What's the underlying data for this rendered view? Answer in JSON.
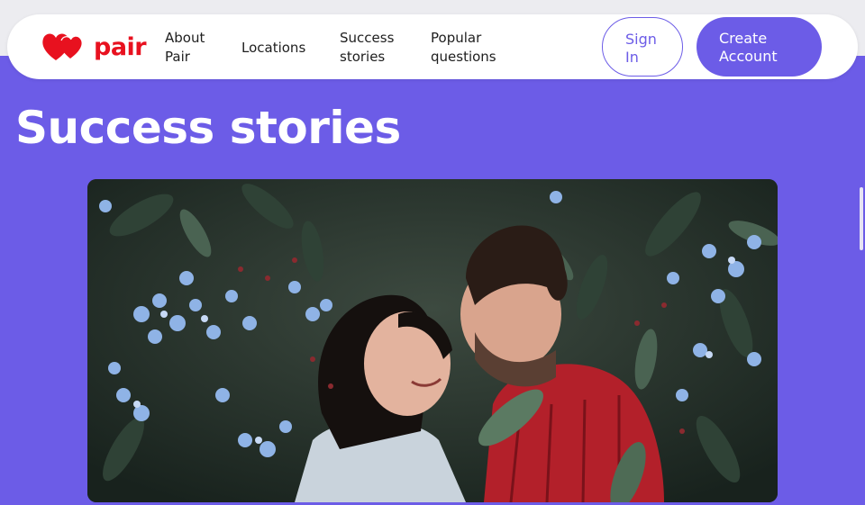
{
  "brand": {
    "name": "pair",
    "color": "#e8111f",
    "accent": "#6c5ce7"
  },
  "nav": {
    "links": [
      {
        "label": "About\nPair"
      },
      {
        "label": "Locations"
      },
      {
        "label": "Success\nstories"
      },
      {
        "label": "Popular\nquestions"
      }
    ],
    "sign_in": "Sign\nIn",
    "create_account": "Create\nAccount"
  },
  "main": {
    "title": "Success stories",
    "hero_image": "couple-photo"
  }
}
